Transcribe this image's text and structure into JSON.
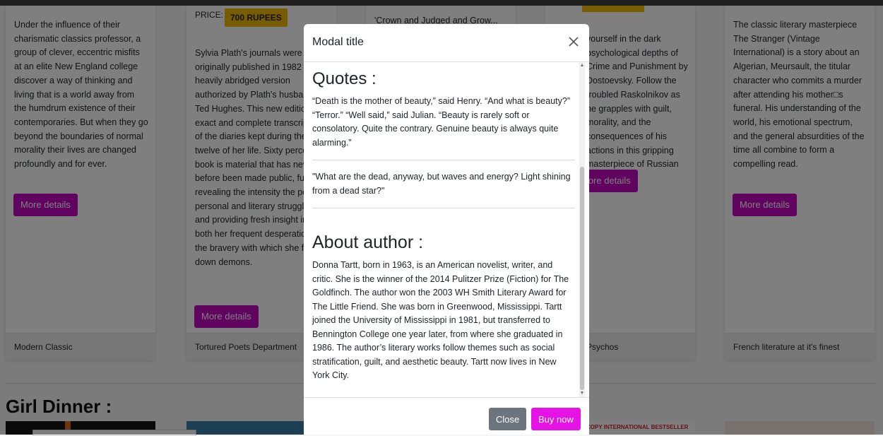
{
  "cards": [
    {
      "description": "Under the influence of their charismatic classics professor, a group of clever, eccentric misfits at an elite New England college discover a way of thinking and living that is a world away from the humdrum existence of their contemporaries. But when they go beyond the boundaries of normal morality their lives are changed profoundly and for ever.",
      "button_label": "More details",
      "footer": "Modern Classic"
    },
    {
      "price_label": "PRICE:",
      "price_value": "700 RUPEES",
      "description": "Sylvia Plath's journals were originally published in 1982 heavily abridged version authorized by Plath's husband Ted Hughes. This new edition an exact and complete transcription of the diaries kept during the last twelve of her life. Sixty percent of book is material that has never before been made public, fully revealing the intensity the poet's personal and literary struggles, and providing fresh insight into both her frequent desperation and the bravery with which she faced down demons.",
      "button_label": "More details",
      "footer": "Tortured Poets Department"
    },
    {
      "description": "'Crown and Judged and Grow...",
      "footer": ""
    },
    {
      "description": "yourself in the dark psychological depths of Crime and Punishment by Dostoevsky. Follow the troubled Raskolnikov as he grapples with guilt, morality, and the consequences of his actions in this gripping masterpiece of Russian literature.",
      "button_label": "More details",
      "footer": "Psychos"
    },
    {
      "description": "The classic literary masterpiece The Stranger (Vintage International) is a story about an Algerian, Meursault, the titular character who commits a murder after attending his mother□s funeral. His understanding of the world, his emotional spectrum, and the general absurdities of the time all combine to form a compelling read.",
      "button_label": "More details",
      "footer": "French literature at it's finest"
    }
  ],
  "section": {
    "title": "Girl Dinner :"
  },
  "banner": {
    "text": "COPY INTERNATIONAL BESTSELLER"
  },
  "modal": {
    "title": "Modal title",
    "quotes_heading": "Quotes :",
    "quotes": [
      "“Death is the mother of beauty,” said Henry. “And what is beauty?” “Terror.” “Well said,” said Julian. “Beauty is rarely soft or consolatory. Quite the contrary. Genuine beauty is always quite alarming.”",
      "\"What are the dead, anyway, but waves and energy? Light shining from a dead star?\""
    ],
    "about_heading": "About author :",
    "about_text": "Donna Tartt, born in 1963, is an American novelist, writer, and critic. She is the winner of the 2014 Pulitzer Prize (Fiction) for The Goldfinch. The author won the 2003 WH Smith Literary Award for The Little Friend. She was born in Greenwood, Mississippi. Tartt joined the University of Mississippi in 1981, but transferred to Bennington College one year later, from where she graduated in 1986. The author’s literary works follow themes such as social stratification, guilt, and aesthetic beauty. Tartt now lives in New York City.",
    "close_label": "Close",
    "buy_label": "Buy now"
  },
  "colors": {
    "accent": "#c209c1",
    "buy": "#e713e6",
    "price_badge": "#f0b800",
    "secondary": "#6c757d"
  }
}
